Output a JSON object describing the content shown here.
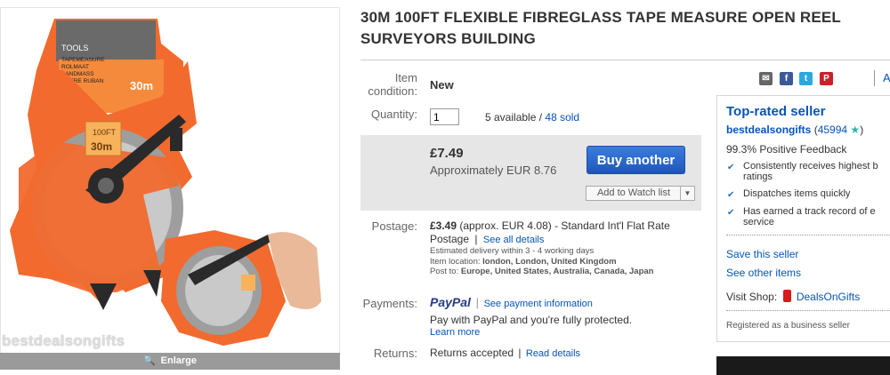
{
  "product": {
    "title": "30M 100FT FLEXIBLE FIBREGLASS TAPE MEASURE OPEN REEL SURVEYORS BUILDING",
    "image_text": {
      "brand": "TOOLS",
      "package_lines": [
        "TAPEMEASURE",
        "ROLMAAT",
        "BANDMASS",
        "MÈTRE RUBAN"
      ],
      "length_badge": "30m",
      "reel_label_top": "100FT",
      "reel_label_bottom": "30m"
    },
    "watermark": "bestdealsongifts",
    "enlarge_label": "Enlarge"
  },
  "item": {
    "condition_label": "Item condition:",
    "condition_value": "New",
    "quantity_label": "Quantity:",
    "quantity_value": "1",
    "available": "5 available /",
    "sold": "48 sold"
  },
  "price": {
    "main": "£7.49",
    "approx": "Approximately EUR 8.76",
    "buy_label": "Buy another",
    "watch_label": "Add to Watch list"
  },
  "postage": {
    "label": "Postage:",
    "amount": "£3.49",
    "detail": "(approx. EUR 4.08) - Standard Int'l Flat Rate",
    "detail2": "Postage",
    "see_all": "See all details",
    "delivery": "Estimated delivery within 3 - 4 working days",
    "location_label": "Item location:",
    "location_value": "london, London, United Kingdom",
    "post_to_label": "Post to:",
    "post_to_value": "Europe, United States, Australia, Canada, Japan"
  },
  "payments": {
    "label": "Payments:",
    "paypal": "PayPal",
    "see_info": "See payment information",
    "note": "Pay with PayPal and you're fully protected.",
    "learn_more": "Learn more"
  },
  "returns": {
    "label": "Returns:",
    "value": "Returns accepted",
    "read_details": "Read details"
  },
  "share": {
    "icons": [
      "email-icon",
      "facebook-icon",
      "twitter-icon",
      "pinterest-icon"
    ],
    "cut_text": "A"
  },
  "seller": {
    "heading": "Top-rated seller",
    "name": "bestdealsongifts",
    "score": "45994",
    "feedback": "99.3% Positive Feedback",
    "bullets": [
      "Consistently receives highest b",
      "ratings",
      "Dispatches items quickly",
      "Has earned a track record of e",
      "service"
    ],
    "save_seller": "Save this seller",
    "other_items": "See other items",
    "visit_shop_label": "Visit Shop:",
    "shop_name": "DealsOnGifts",
    "registered": "Registered as a business seller"
  },
  "colors": {
    "link": "#0654ba",
    "buy_button": "#2e66c7",
    "price_box": "#e6e6e6",
    "product_orange": "#f26a2e"
  }
}
